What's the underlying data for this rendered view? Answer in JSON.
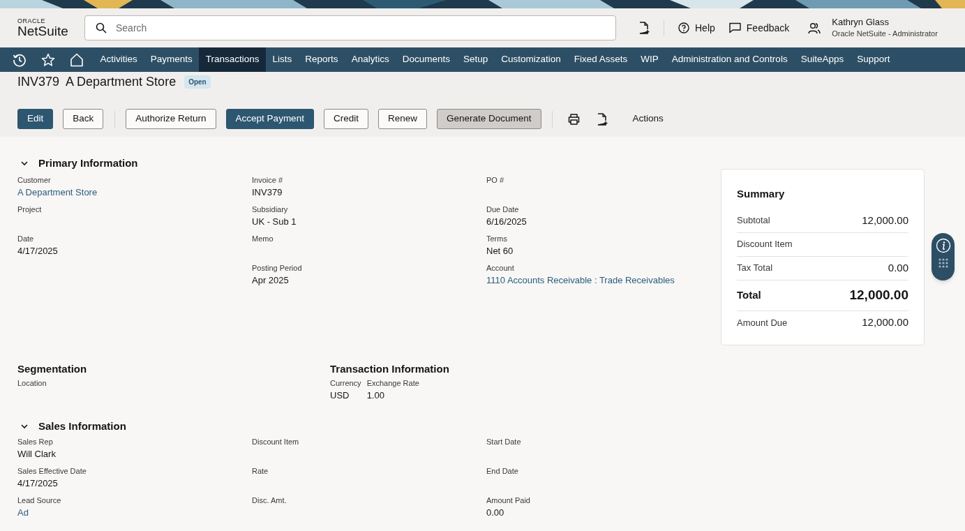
{
  "header": {
    "logo_top": "ORACLE",
    "logo": "NetSuite",
    "search": {
      "placeholder": "Search"
    },
    "help": "Help",
    "feedback": "Feedback",
    "user": {
      "name": "Kathryn Glass",
      "role": "Oracle NetSuite - Administrator"
    }
  },
  "nav": [
    {
      "label": "Activities",
      "selected": false
    },
    {
      "label": "Payments",
      "selected": false
    },
    {
      "label": "Transactions",
      "selected": true
    },
    {
      "label": "Lists",
      "selected": false
    },
    {
      "label": "Reports",
      "selected": false
    },
    {
      "label": "Analytics",
      "selected": false
    },
    {
      "label": "Documents",
      "selected": false
    },
    {
      "label": "Setup",
      "selected": false
    },
    {
      "label": "Customization",
      "selected": false
    },
    {
      "label": "Fixed Assets",
      "selected": false
    },
    {
      "label": "WIP",
      "selected": false
    },
    {
      "label": "Administration and Controls",
      "selected": false
    },
    {
      "label": "SuiteApps",
      "selected": false
    },
    {
      "label": "Support",
      "selected": false
    }
  ],
  "record": {
    "id": "INV379",
    "name": "A Department Store",
    "status": "Open"
  },
  "toolbar": {
    "button_groups": [
      [
        {
          "label": "Edit",
          "kind": "primary"
        },
        {
          "label": "Back",
          "kind": "secondary"
        }
      ],
      [
        {
          "label": "Authorize Return",
          "kind": "secondary"
        },
        {
          "label": "Accept Payment",
          "kind": "primary"
        },
        {
          "label": "Credit",
          "kind": "secondary"
        },
        {
          "label": "Renew",
          "kind": "secondary"
        },
        {
          "label": "Generate Document",
          "kind": "pressed"
        }
      ]
    ],
    "actions": "Actions"
  },
  "primary_information": {
    "title": "Primary Information",
    "expanded": true,
    "columns": [
      [
        {
          "label": "Customer",
          "value": "A Department Store",
          "link": true
        },
        {
          "label": "Project"
        },
        {
          "label": "Date",
          "value": "4/17/2025",
          "link": false
        }
      ],
      [
        {
          "label": "Invoice #",
          "value": "INV379",
          "link": false
        },
        {
          "label": "Subsidiary",
          "value": "UK - Sub 1",
          "link": false
        },
        {
          "label": "Memo"
        },
        {
          "label": "Posting Period",
          "value": "Apr 2025",
          "link": false
        }
      ],
      [
        {
          "label": "PO #"
        },
        {
          "label": "Due Date",
          "value": "6/16/2025",
          "link": false
        },
        {
          "label": "Terms",
          "value": "Net 60",
          "link": false
        },
        {
          "label": "Account",
          "value": "1110 Accounts Receivable : Trade Receivables",
          "link": true
        }
      ]
    ]
  },
  "summary": {
    "title": "Summary",
    "rows": [
      {
        "label": "Subtotal",
        "value": "12,000.00",
        "kind": "normal"
      },
      {
        "label": "Discount Item",
        "kind": "normal"
      },
      {
        "label": "Tax Total",
        "value": "0.00",
        "kind": "normal"
      },
      {
        "label": "Total",
        "value": "12,000.00",
        "kind": "total"
      },
      {
        "label": "Amount Due",
        "value": "12,000.00",
        "kind": "normal"
      }
    ]
  },
  "segmentation": {
    "title": "Segmentation",
    "fields": [
      {
        "label": "Location"
      }
    ]
  },
  "transaction_information": {
    "title": "Transaction Information",
    "fields": [
      {
        "label": "Currency",
        "value": "USD",
        "link": false
      },
      {
        "label": "Exchange Rate",
        "value": "1.00",
        "link": false
      }
    ]
  },
  "sales_information": {
    "title": "Sales Information",
    "expanded": true,
    "columns": [
      [
        {
          "label": "Sales Rep",
          "value": "Will Clark",
          "link": false
        },
        {
          "label": "Sales Effective Date",
          "value": "4/17/2025",
          "link": false
        },
        {
          "label": "Lead Source",
          "value": "Ad",
          "link": true
        }
      ],
      [
        {
          "label": "Discount Item"
        },
        {
          "label": "Rate"
        },
        {
          "label": "Disc. Amt."
        }
      ],
      [
        {
          "label": "Start Date"
        },
        {
          "label": "End Date"
        },
        {
          "label": "Amount Paid",
          "value": "0.00",
          "link": false
        }
      ]
    ]
  }
}
